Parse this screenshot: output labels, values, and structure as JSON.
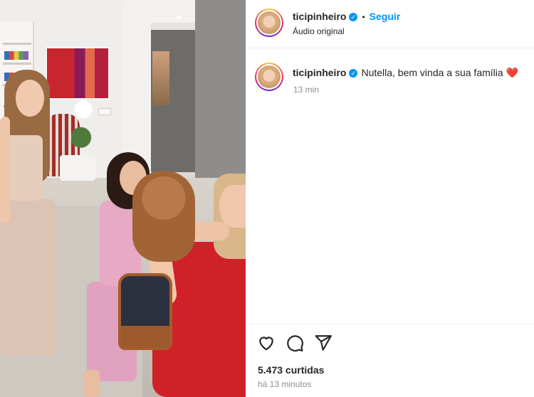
{
  "post": {
    "username": "ticipinheiro",
    "follow_label": "Seguir",
    "separator": "•",
    "audio": "Áudio original",
    "verified_mark": "✓"
  },
  "caption": {
    "username": "ticipinheiro",
    "text": "Nutella, bem vinda a sua família ❤️",
    "time": "13 min"
  },
  "actions": {
    "icons": [
      "heart-icon",
      "comment-icon",
      "share-icon"
    ]
  },
  "stats": {
    "likes": "5.473 curtidas",
    "time_ago": "há 13 minutos"
  },
  "colors": {
    "accent": "#0095f6",
    "text": "#262626",
    "muted": "#8e8e8e",
    "divider": "#efefef",
    "dress": "#cf2127"
  }
}
